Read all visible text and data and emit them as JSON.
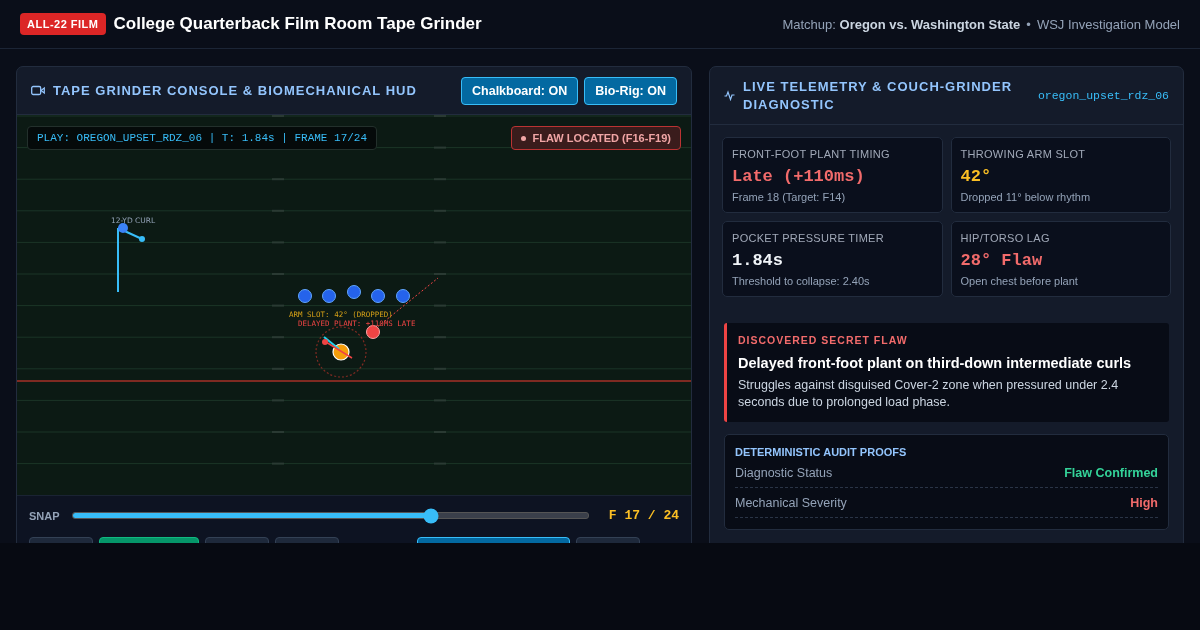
{
  "header": {
    "badge": "ALL-22 FILM",
    "title": "College Quarterback Film Room Tape Grinder",
    "matchup_label": "Matchup:",
    "matchup": "Oregon vs. Washington State",
    "separator": "•",
    "model": "WSJ Investigation Model"
  },
  "console": {
    "title": "TAPE GRINDER CONSOLE & BIOMECHANICAL HUD",
    "toggles": [
      {
        "label": "Chalkboard: ON",
        "on": true
      },
      {
        "label": "Bio-Rig: ON",
        "on": true
      }
    ],
    "play_info": "PLAY: OREGON_UPSET_RDZ_06 | T: 1.84s | FRAME 17/24",
    "flaw_badge": "FLAW LOCATED (F16-F19)",
    "field": {
      "route_label": "12-YD CURL",
      "arm_label": "ARM SLOT: 42° (DROPPED)",
      "plant_label": "DELAYED PLANT: +110MS LATE"
    },
    "scrubber": {
      "label": "SNAP",
      "level": 0.696,
      "reading": "F 17 / 24"
    },
    "buttons": [
      {
        "kind": "plain"
      },
      {
        "kind": "green"
      },
      {
        "kind": "plain"
      },
      {
        "kind": "plain"
      },
      {
        "kind": "spacer"
      },
      {
        "kind": "blue"
      },
      {
        "kind": "plain"
      }
    ]
  },
  "telemetry": {
    "title": "LIVE TELEMETRY & COUCH-GRINDER DIAGNOSTIC",
    "session": "oregon_upset_rdz_06",
    "metrics": [
      {
        "label": "FRONT-FOOT PLANT TIMING",
        "value": "Late (+110ms)",
        "note": "Frame 18 (Target: F14)",
        "color": "#f26b6b"
      },
      {
        "label": "THROWING ARM SLOT",
        "value": "42°",
        "note": "Dropped 11° below rhythm",
        "color": "#fbbf24"
      },
      {
        "label": "POCKET PRESSURE TIMER",
        "value": "1.84s",
        "note": "Threshold to collapse: 2.40s",
        "color": "#f1f5f9"
      },
      {
        "label": "HIP/TORSO LAG",
        "value": "28° Flaw",
        "note": "Open chest before plant",
        "color": "#f26b6b"
      }
    ],
    "flaw": {
      "eyebrow": "DISCOVERED SECRET FLAW",
      "headline": "Delayed front-foot plant on third-down intermediate curls",
      "body": "Struggles against disguised Cover-2 zone when pressured under 2.4 seconds due to prolonged load phase."
    },
    "audit": {
      "title": "DETERMINISTIC AUDIT PROOFS",
      "rows": [
        {
          "label": "Diagnostic Status",
          "value": "Flaw Confirmed",
          "color": "#34d399"
        },
        {
          "label": "Mechanical Severity",
          "value": "High",
          "color": "#f26b6b"
        }
      ]
    }
  }
}
